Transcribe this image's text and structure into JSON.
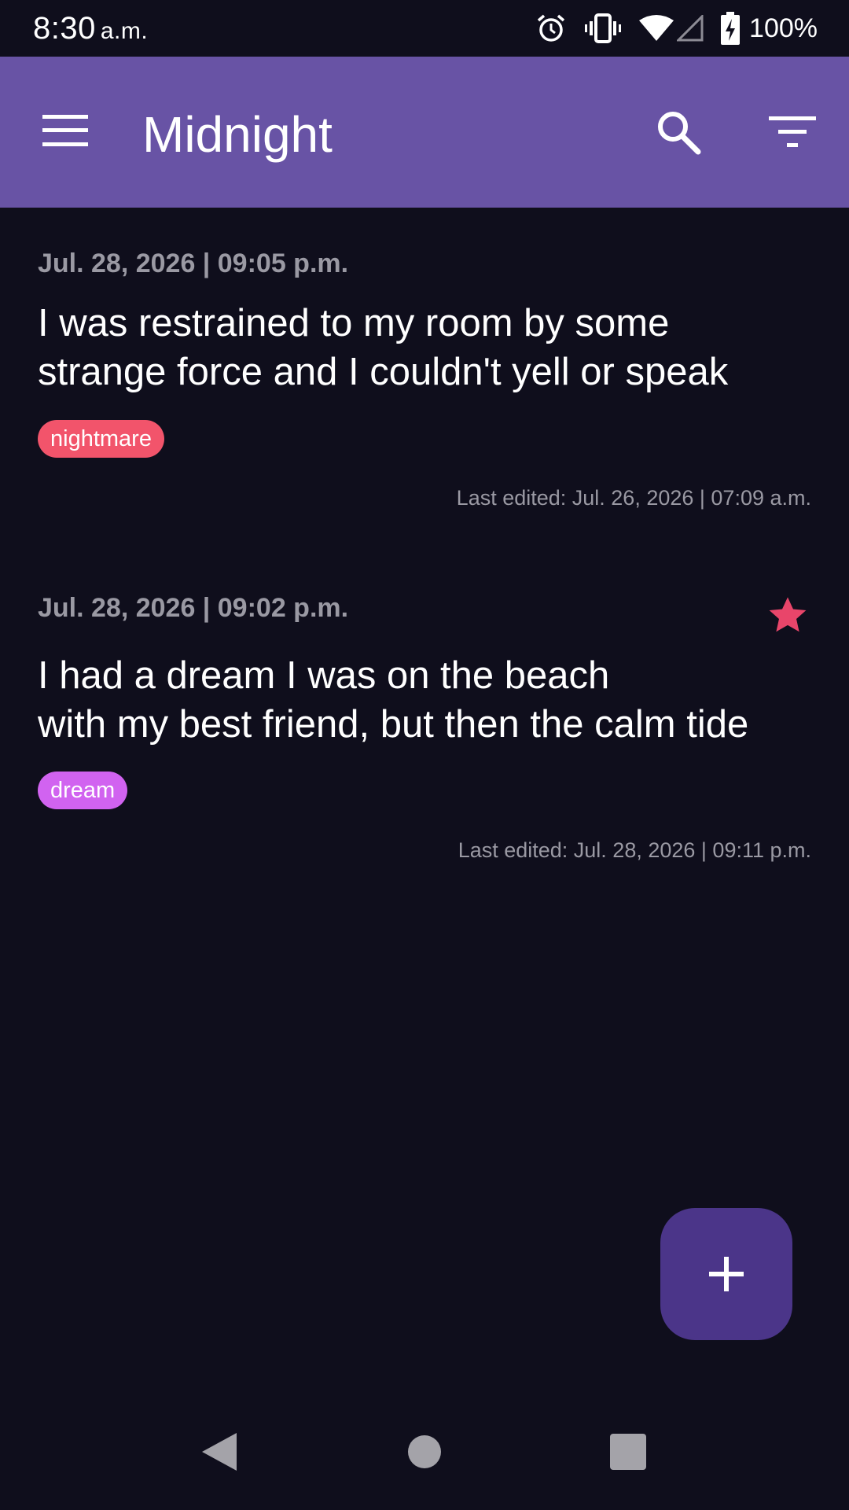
{
  "status_bar": {
    "time": "8:30",
    "ampm": "a.m.",
    "battery": "100%",
    "icons": [
      "alarm-icon",
      "vibrate-icon",
      "wifi-icon",
      "cell-signal-icon",
      "battery-charging-icon"
    ]
  },
  "app_bar": {
    "title": "Midnight",
    "icons": [
      "menu-icon",
      "search-icon",
      "filter-icon"
    ],
    "color": "#6853a5"
  },
  "entries": [
    {
      "date": "Jul. 28, 2026 | 09:05 p.m.",
      "text_lines": [
        "I was restrained to my room by some",
        "strange force and I couldn't yell or speak"
      ],
      "tag": "nightmare",
      "tag_color": "#f2546b",
      "last_edited": "Last edited: Jul. 26, 2026 | 07:09 a.m.",
      "favorite": false
    },
    {
      "date": "Jul. 28, 2026 | 09:02 p.m.",
      "text_lines": [
        "I had a dream I was on the beach",
        "with my best friend, but then the calm tide"
      ],
      "tag": "dream",
      "tag_color": "#d163f0",
      "last_edited": "Last edited: Jul. 28, 2026 | 09:11 p.m.",
      "favorite": true,
      "favorite_icon": "star-icon",
      "favorite_color": "#e9456a"
    }
  ],
  "fab": {
    "icon": "plus-icon",
    "color": "#4b3589"
  },
  "nav_bar": {
    "icons": [
      "back-icon",
      "home-icon",
      "recents-icon"
    ]
  }
}
